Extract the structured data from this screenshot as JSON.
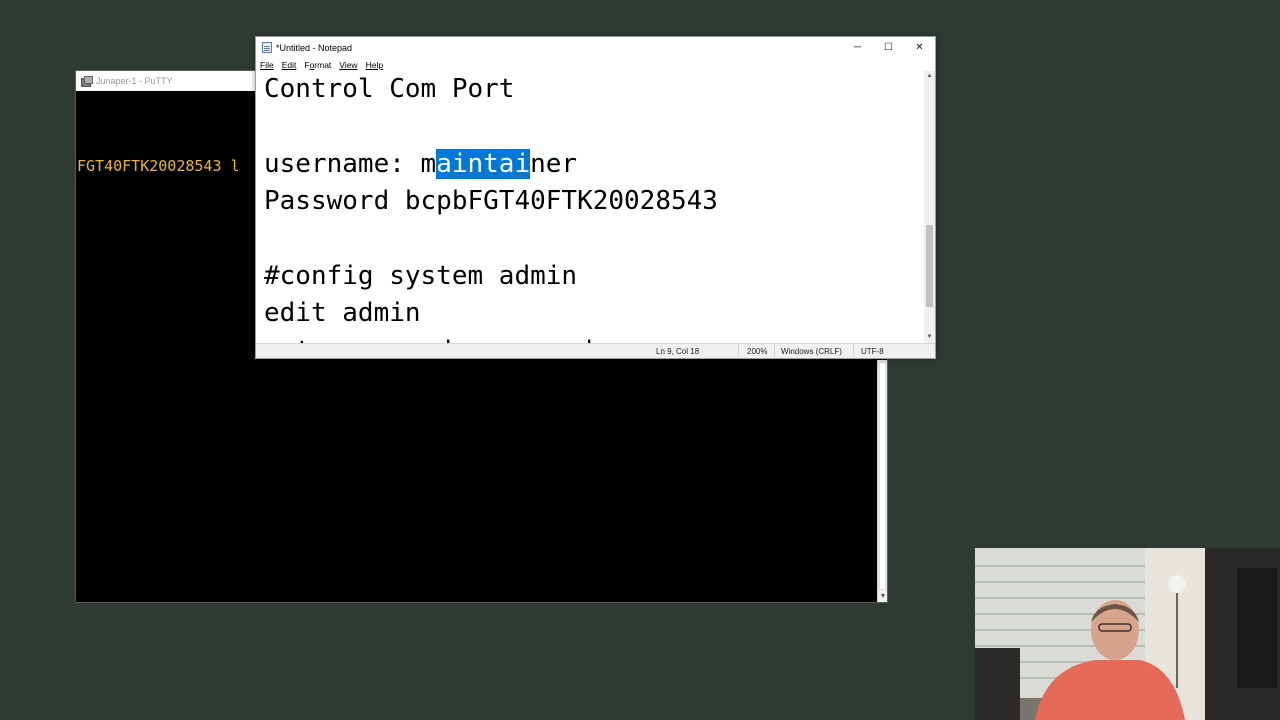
{
  "putty": {
    "title": "Junaper-1 - PuTTY",
    "terminal_line": "FGT40FTK20028543 l"
  },
  "notepad": {
    "title": "*Untitled - Notepad",
    "window_buttons": {
      "minimize": "─",
      "maximize": "☐",
      "close": "✕"
    },
    "menu": [
      "File",
      "Edit",
      "Format",
      "View",
      "Help"
    ],
    "menu_access_keys": [
      "F",
      "E",
      "o",
      "V",
      "H"
    ],
    "lines": {
      "line1": "Control Com Port",
      "line2": "",
      "line3_pre": "username: m",
      "line3_sel": "aintai",
      "line3_post": "ner",
      "line4": "Password bcpbFGT40FTK20028543",
      "line5": "",
      "line6": "#config system admin",
      "line7": "edit admin",
      "line8": "set password password"
    },
    "status": {
      "position": "Ln 9, Col 18",
      "zoom": "200%",
      "line_ending": "Windows (CRLF)",
      "encoding": "UTF-8"
    },
    "colors": {
      "selection": "#0078d7",
      "terminal_text": "#e8b730",
      "desktop": "#2f3a33"
    }
  },
  "webcam": {
    "description_icon": "webcam-feed"
  }
}
